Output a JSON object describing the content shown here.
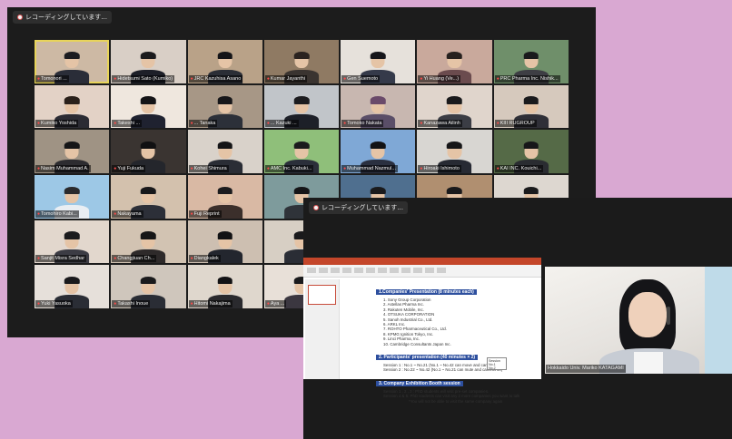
{
  "back_window": {
    "recording_label": "レコーディングしています...",
    "tiles": [
      {
        "name": "Tomonori ...",
        "bg": "#cdb9a4",
        "shirt": "#2a2d38",
        "hair": "#1c1c20",
        "active": true
      },
      {
        "name": "Hidetsumi Sato (Kumiko)",
        "bg": "#d9cfc6",
        "shirt": "#1d1f28",
        "hair": "#1b1b1d"
      },
      {
        "name": "JRC Kazuhisa Asano",
        "bg": "#b9a288",
        "shirt": "#2b2e36",
        "hair": "#141417"
      },
      {
        "name": "Kumar Jayanthi",
        "bg": "#8f7a63",
        "shirt": "#3a3430",
        "hair": "#2b2320"
      },
      {
        "name": "Gen Suemoto",
        "bg": "#e6e1db",
        "shirt": "#353a4a",
        "hair": "#15151a"
      },
      {
        "name": "Yi Huang (Ve...)",
        "bg": "#c9a99c",
        "shirt": "#6b4b4e",
        "hair": "#26201e"
      },
      {
        "name": "PRC Pharma Inc. Nishik...",
        "bg": "#6f8f6a",
        "shirt": "#3e3e44",
        "hair": "#1a1a1c"
      },
      {
        "name": "Kumiko Yoshida",
        "bg": "#e3d2c6",
        "shirt": "#2b2b33",
        "hair": "#2a201a"
      },
      {
        "name": "Takeshi ...",
        "bg": "#efe7de",
        "shirt": "#1f2230",
        "hair": "#141416"
      },
      {
        "name": "... Tanaka",
        "bg": "#a79786",
        "shirt": "#2c3039",
        "hair": "#17171a"
      },
      {
        "name": "... Kazuki ...",
        "bg": "#c1c5c9",
        "shirt": "#1d2028",
        "hair": "#1c1c1f"
      },
      {
        "name": "Tomoko Nakata",
        "bg": "#c8b7b0",
        "shirt": "#5a4e68",
        "hair": "#6a4a6a"
      },
      {
        "name": "Kanazawa Ailinh",
        "bg": "#e0d5cc",
        "shirt": "#3b3d45",
        "hair": "#1a1a1c"
      },
      {
        "name": "KIII RUGROUP",
        "bg": "#d6c9bd",
        "shirt": "#2f2f37",
        "hair": "#1a1a1d"
      },
      {
        "name": "Nasim Muhammad A.",
        "bg": "#9f9384",
        "shirt": "#2d2c30",
        "hair": "#151517"
      },
      {
        "name": "Yuji Fukuda",
        "bg": "#3a3431",
        "shirt": "#24262c",
        "hair": "#101012"
      },
      {
        "name": "Kohei Shimura",
        "bg": "#d9d2ca",
        "shirt": "#2a2d35",
        "hair": "#141416"
      },
      {
        "name": "AMC Inc. Kabuki...",
        "bg": "#8fbf7a",
        "shirt": "#2b2f3a",
        "hair": "#1b1b1d"
      },
      {
        "name": "Muhammad Nazmul...",
        "bg": "#7fa8d6",
        "shirt": "#2a3040",
        "hair": "#121214"
      },
      {
        "name": "Hiroaki Ishimoto",
        "bg": "#d8d6d2",
        "shirt": "#272a33",
        "hair": "#161618"
      },
      {
        "name": "KAI INC. Kouichi...",
        "bg": "#556a47",
        "shirt": "#2a2c31",
        "hair": "#171719"
      },
      {
        "name": "Tomohiro Kabi...",
        "bg": "#9dc8e6",
        "shirt": "#e9eef3",
        "hair": "#2a2a2c"
      },
      {
        "name": "Nakayama",
        "bg": "#d3c1ad",
        "shirt": "#2c2f38",
        "hair": "#18181a"
      },
      {
        "name": "Fuji Reprint",
        "bg": "#d9b9a4",
        "shirt": "#3b2f2b",
        "hair": "#1c1c1e"
      },
      {
        "name": "",
        "bg": "#7e9b9c",
        "shirt": "#2f3339",
        "hair": "#151517"
      },
      {
        "name": "",
        "bg": "#4f6f8f",
        "shirt": "#2a2d35",
        "hair": "#1a1a1c"
      },
      {
        "name": "",
        "bg": "#b08f70",
        "shirt": "#2a2d35",
        "hair": "#1a1a1c"
      },
      {
        "name": "",
        "bg": "#ddd7d0",
        "shirt": "#2a2d35",
        "hair": "#1a1a1c"
      },
      {
        "name": "Sanjit Misra Sedhar",
        "bg": "#e2d7cd",
        "shirt": "#3c3c44",
        "hair": "#1b1b1d"
      },
      {
        "name": "Changjiuan Ch...",
        "bg": "#d2c3b2",
        "shirt": "#2e2a2a",
        "hair": "#161617"
      },
      {
        "name": "Diangkalek",
        "bg": "#cdbfb1",
        "shirt": "#23262e",
        "hair": "#121214"
      },
      {
        "name": "",
        "bg": "#d7cfc4",
        "shirt": "#2a2d35",
        "hair": "#1a1a1c"
      },
      {
        "name": "",
        "bg": "#1b1b1b",
        "shirt": "#1b1b1b",
        "hair": "#1b1b1b"
      },
      {
        "name": "",
        "bg": "#1b1b1b",
        "shirt": "#1b1b1b",
        "hair": "#1b1b1b"
      },
      {
        "name": "",
        "bg": "#1b1b1b",
        "shirt": "#1b1b1b",
        "hair": "#1b1b1b"
      },
      {
        "name": "Yuki Yasuoka",
        "bg": "#e6e0da",
        "shirt": "#2a2d35",
        "hair": "#1a1a1c"
      },
      {
        "name": "Takashi Inoue",
        "bg": "#cfc6bc",
        "shirt": "#2a2d35",
        "hair": "#1a1a1c"
      },
      {
        "name": "Hitomi Nakajima",
        "bg": "#dfd7cd",
        "shirt": "#2a2a2e",
        "hair": "#121214"
      },
      {
        "name": "Aya ...",
        "bg": "#e8e0d8",
        "shirt": "#3b3740",
        "hair": "#1a1a1c"
      },
      {
        "name": "",
        "bg": "#1b1b1b",
        "shirt": "#1b1b1b",
        "hair": "#1b1b1b"
      },
      {
        "name": "",
        "bg": "#1b1b1b",
        "shirt": "#1b1b1b",
        "hair": "#1b1b1b"
      },
      {
        "name": "",
        "bg": "#1b1b1b",
        "shirt": "#1b1b1b",
        "hair": "#1b1b1b"
      }
    ]
  },
  "front_window": {
    "recording_label": "レコーディングしています...",
    "slide": {
      "section1": "1.Companies' Presentation (8 minutes each)",
      "companies": [
        "1.  Sony Group Corporation",
        "2.  Astellas Pharma Inc.",
        "3.  Rakuten Mobile, Inc.",
        "4.  OTSUKA CORPORATION",
        "5.  Sanoh Industrial Co., Ltd.",
        "6.  ARKL Inc.",
        "7.  ROHTO Pharmaceutical Co., Ltd.",
        "8.  KPMG Ignition Tokyo, Inc.",
        "9.  Linci Pharma, Inc.",
        "10. Cambridge Consultants Japan Inc."
      ],
      "section2": "2. Participants' presentation (40 minutes × 2)",
      "sessions": [
        "Session 1 : No.1 ~ No.21 (No.1 ~ No.42 can move and camera off)",
        "Session 2 : No.22 ~ No.42 (No.1 ~ No.21 can mute and camera off)"
      ],
      "legend": [
        "Session",
        "No.1",
        "No.2"
      ],
      "section3": "3. Company Exhibition Booth session",
      "notes": [
        "Session 1 , 2 , 3 : PhD students will visit pre-set companies.",
        "Session 4 & 5: PhD students can visit any 2 more companies you want to talk",
        "*You will not be able to visit the same company again"
      ]
    },
    "speaker_name": "Hokkaido Univ. Mariko KATAGAMI"
  },
  "colors": {
    "accent_blue": "#2d4f9e",
    "ppt_red": "#c4462a",
    "background": "#d9a8d2"
  }
}
